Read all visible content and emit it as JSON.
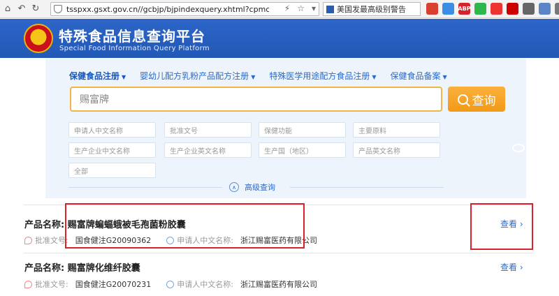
{
  "browser": {
    "url": "tsspxx.gsxt.gov.cn//gcbjp/bjpindexquery.xhtml?cpmc=",
    "tab_title": "美国发最高级别警告",
    "ext_abp": "ABP"
  },
  "header": {
    "title": "特殊食品信息查询平台",
    "subtitle": "Special Food Information Query Platform"
  },
  "search": {
    "tabs": [
      {
        "label": "保健食品注册",
        "active": true
      },
      {
        "label": "婴幼儿配方乳粉产品配方注册",
        "active": false
      },
      {
        "label": "特殊医学用途配方食品注册",
        "active": false
      },
      {
        "label": "保健食品备案",
        "active": false
      }
    ],
    "query": "赐富牌",
    "button_label": "查询",
    "fields": [
      "申请人中文名称",
      "批准文号",
      "保健功能",
      "主要原料",
      "生产企业中文名称",
      "生产企业英文名称",
      "生产国（地区）",
      "产品英文名称",
      "全部"
    ],
    "advanced_label": "高级查询"
  },
  "results": [
    {
      "name_label": "产品名称:",
      "name": "赐富牌蝙蝠蛾被毛孢菌粉胶囊",
      "approval_label": "批准文号:",
      "approval_no": "国食健注G20090362",
      "applicant_label": "申请人中文名称:",
      "applicant": "浙江赐富医药有限公司",
      "view_label": "查看"
    },
    {
      "name_label": "产品名称:",
      "name": "赐富牌化维纤胶囊",
      "approval_label": "批准文号:",
      "approval_no": "国食健注G20070231",
      "applicant_label": "申请人中文名称:",
      "applicant": "浙江赐富医药有限公司",
      "view_label": "查看"
    }
  ],
  "colors": {
    "header_blue": "#2358b6",
    "accent_orange": "#f29a18",
    "link_blue": "#2a6acb",
    "highlight_red": "#d9222a"
  }
}
